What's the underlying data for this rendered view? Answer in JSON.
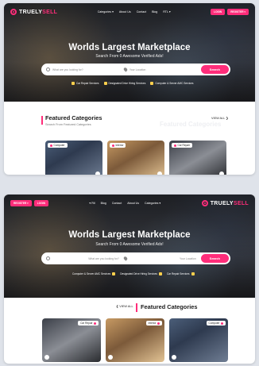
{
  "colors": {
    "brand": "#ff2d7a",
    "dark": "#1b1b1b",
    "page_bg": "#dfe3ea"
  },
  "ltr": {
    "logo": {
      "prefix": "TRUELY",
      "accent": "SELL"
    },
    "nav": [
      "Categories ▾",
      "About Us",
      "Contact",
      "Blog",
      "RTL ▾"
    ],
    "auth": {
      "login": "LOGIN",
      "register": "REGISTER ▾"
    },
    "hero": {
      "title": "Worlds Largest Marketplace",
      "subtitle": "Search From 0 Awesome Verified Ads!"
    },
    "search": {
      "keyword_placeholder": "What are you looking for?",
      "location_placeholder": "Your Location",
      "button": "Search"
    },
    "tags": [
      "Car Repair Services",
      "Designated Drive Hiring Services",
      "Computer & Server AMC Services"
    ],
    "featured": {
      "title": "Featured Categories",
      "subtitle": "Search From Featured Categories",
      "view_all": "VIEW ALL",
      "ghost": "Featured Categories"
    },
    "categories": [
      {
        "label": "Computer",
        "icon": "computer-icon"
      },
      {
        "label": "Interior",
        "icon": "interior-icon"
      },
      {
        "label": "Car Repair",
        "icon": "car-icon"
      }
    ]
  },
  "rtl": {
    "logo": {
      "prefix": "TRUELY",
      "accent": "SELL"
    },
    "nav": [
      "Blog",
      "Contact",
      "About Us",
      "Categories ▾"
    ],
    "nav_lead": "▾ Rtl",
    "auth": {
      "register": "REGISTER ▾",
      "login": "LOGIN"
    },
    "hero": {
      "title": "Worlds Largest Marketplace",
      "subtitle": "Search From 0 Awesome Verified Ads!"
    },
    "search": {
      "keyword_placeholder": "What are you looking for?",
      "location_placeholder": "Your Location",
      "button": "Search"
    },
    "tags": [
      "Computer & Server AMC Services",
      "Designated Drive Hiring Services",
      "Car Repair Services"
    ],
    "featured": {
      "title": "Featured Categories",
      "view_all": "VIEW ALL"
    },
    "categories": [
      {
        "label": "Car Repair",
        "icon": "car-icon"
      },
      {
        "label": "Interior",
        "icon": "interior-icon"
      },
      {
        "label": "Computer",
        "icon": "computer-icon"
      }
    ]
  }
}
